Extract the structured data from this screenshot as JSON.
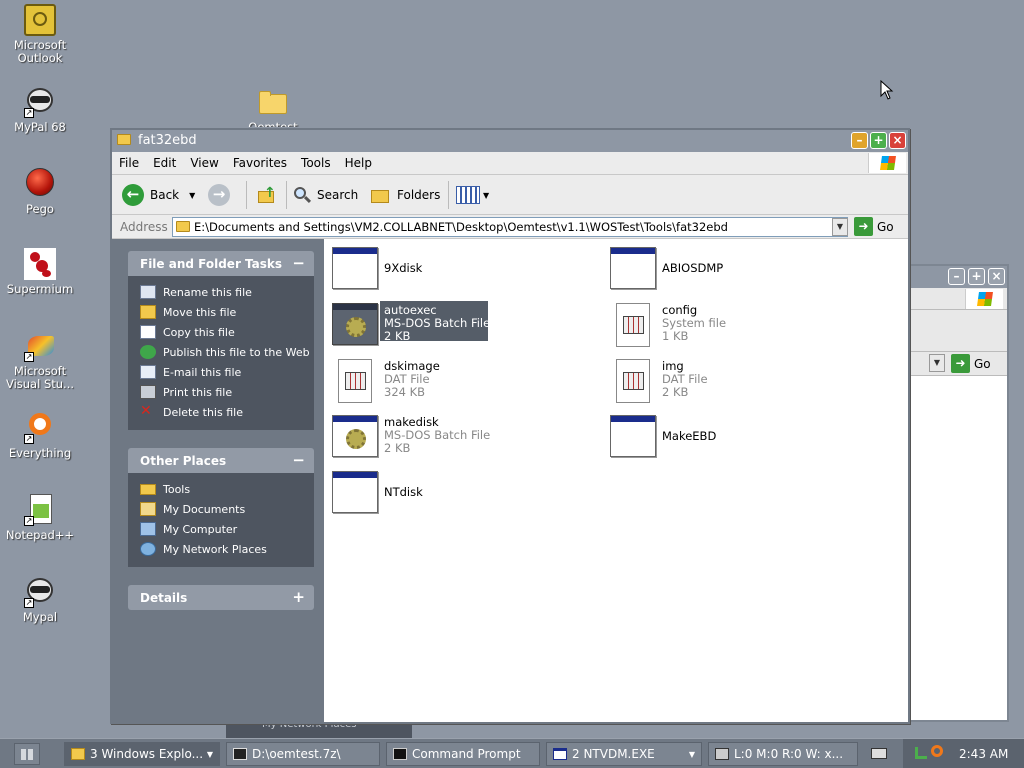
{
  "desktop": {
    "icons": [
      {
        "label": "Microsoft Outlook",
        "icon": "outlook-icon"
      },
      {
        "label": "MyPal 68",
        "icon": "raccoon-icon"
      },
      {
        "label": "Oemtest",
        "icon": "folder-icon"
      },
      {
        "label": "Pego",
        "icon": "red-orb-icon"
      },
      {
        "label": "Supermium",
        "icon": "ant-icon"
      },
      {
        "label": "Microsoft Visual Stu...",
        "icon": "visual-studio-icon"
      },
      {
        "label": "Everything",
        "icon": "everything-icon"
      },
      {
        "label": "Notepad++",
        "icon": "notepad-plus-icon"
      },
      {
        "label": "Mypal",
        "icon": "raccoon-icon"
      }
    ]
  },
  "window": {
    "title": "fat32ebd",
    "menu": [
      "File",
      "Edit",
      "View",
      "Favorites",
      "Tools",
      "Help"
    ],
    "toolbar": {
      "back": "Back",
      "search": "Search",
      "folders": "Folders"
    },
    "address": {
      "label": "Address",
      "path": "E:\\Documents and Settings\\VM2.COLLABNET\\Desktop\\Oemtest\\v1.1\\WOSTest\\Tools\\fat32ebd",
      "go": "Go"
    },
    "task_pane": {
      "file_tasks": {
        "title": "File and Folder Tasks",
        "items": [
          "Rename this file",
          "Move this file",
          "Copy this file",
          "Publish this file to the Web",
          "E-mail this file",
          "Print this file",
          "Delete this file"
        ]
      },
      "other_places": {
        "title": "Other Places",
        "items": [
          "Tools",
          "My Documents",
          "My Computer",
          "My Network Places"
        ]
      },
      "details": {
        "title": "Details"
      }
    },
    "files": [
      {
        "name": "9Xdisk",
        "type": "",
        "size": "",
        "icon": "app"
      },
      {
        "name": "ABIOSDMP",
        "type": "",
        "size": "",
        "icon": "app"
      },
      {
        "name": "autoexec",
        "type": "MS-DOS Batch File",
        "size": "2 KB",
        "icon": "batch",
        "selected": true
      },
      {
        "name": "config",
        "type": "System file",
        "size": "1 KB",
        "icon": "dat"
      },
      {
        "name": "dskimage",
        "type": "DAT File",
        "size": "324 KB",
        "icon": "dat"
      },
      {
        "name": "img",
        "type": "DAT File",
        "size": "2 KB",
        "icon": "dat"
      },
      {
        "name": "makedisk",
        "type": "MS-DOS Batch File",
        "size": "2 KB",
        "icon": "batch"
      },
      {
        "name": "MakeEBD",
        "type": "",
        "size": "",
        "icon": "app"
      },
      {
        "name": "NTdisk",
        "type": "",
        "size": "",
        "icon": "app"
      }
    ]
  },
  "background_window": {
    "go": "Go",
    "obscured_text": "My Network Places"
  },
  "taskbar": {
    "items": [
      {
        "label": "3 Windows Explo...",
        "icon": "folder-icon"
      },
      {
        "label": "D:\\oemtest.7z\\",
        "icon": "archive-icon"
      },
      {
        "label": "Command Prompt",
        "icon": "cmd-icon"
      },
      {
        "label": "2 NTVDM.EXE",
        "icon": "window-icon"
      },
      {
        "label": "L:0 M:0 R:0 W: x...",
        "icon": "monitor-icon"
      }
    ],
    "clock": "2:43 AM"
  },
  "colors": {
    "desktop": "#8e97a4",
    "pane": "#6f7884",
    "selection": "#555d68"
  }
}
